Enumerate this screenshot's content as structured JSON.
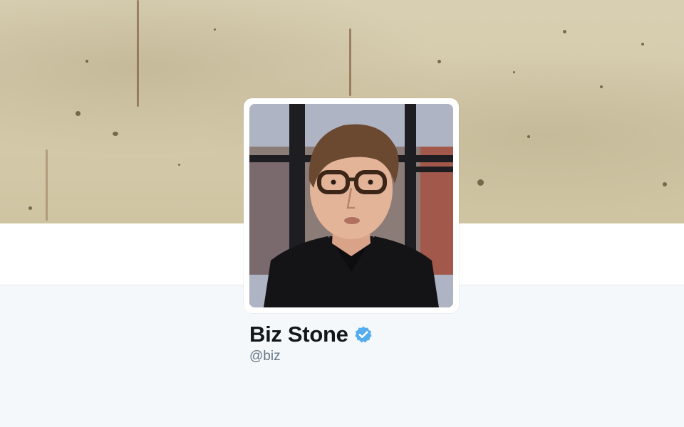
{
  "profile": {
    "name": "Biz Stone",
    "handle": "@biz",
    "verified": true,
    "verified_icon": "verified-badge-icon"
  },
  "colors": {
    "verified_badge": "#55acee",
    "name_text": "#14171a",
    "handle_text": "#657786",
    "page_background": "#f5f8fa",
    "banner_tone": "#d4caaa"
  }
}
